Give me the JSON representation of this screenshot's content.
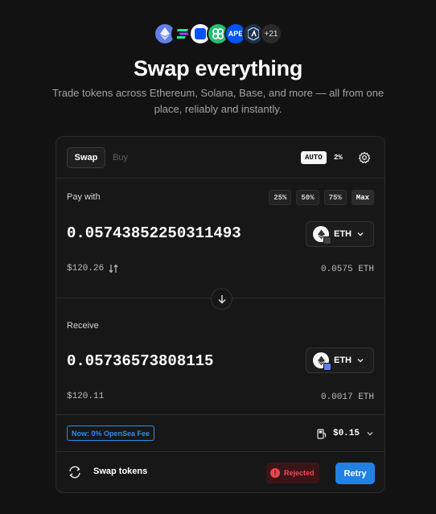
{
  "header": {
    "chains": [
      {
        "name": "ethereum-icon",
        "label": ""
      },
      {
        "name": "solana-icon",
        "label": ""
      },
      {
        "name": "base-icon",
        "label": ""
      },
      {
        "name": "apechain-icon",
        "label": ""
      },
      {
        "name": "ape-icon",
        "label": "APE"
      },
      {
        "name": "arbitrum-icon",
        "label": ""
      }
    ],
    "more_chains": "+21",
    "title": "Swap everything",
    "subtitle": "Trade tokens across Ethereum, Solana, Base, and more — all from one place, reliably and instantly."
  },
  "toolbar": {
    "tab_swap": "Swap",
    "tab_buy": "Buy",
    "auto_label": "AUTO",
    "slippage": "2%"
  },
  "pay": {
    "label": "Pay with",
    "percent_options": [
      "25%",
      "50%",
      "75%",
      "Max"
    ],
    "amount": "0.05743852250311493",
    "token": "ETH",
    "usd_value": "$120.26",
    "balance": "0.0575 ETH"
  },
  "receive": {
    "label": "Receive",
    "amount": "0.05736573808115",
    "token": "ETH",
    "usd_value": "$120.11",
    "balance": "0.0017 ETH"
  },
  "fees": {
    "badge": "Now: 0% OpenSea Fee",
    "gas": "$0.15"
  },
  "action": {
    "label": "Swap tokens",
    "status": "Rejected",
    "retry": "Retry"
  },
  "colors": {
    "background": "#121212",
    "card": "#171717",
    "accent_blue": "#2081e2",
    "error_red": "#f0484f"
  }
}
